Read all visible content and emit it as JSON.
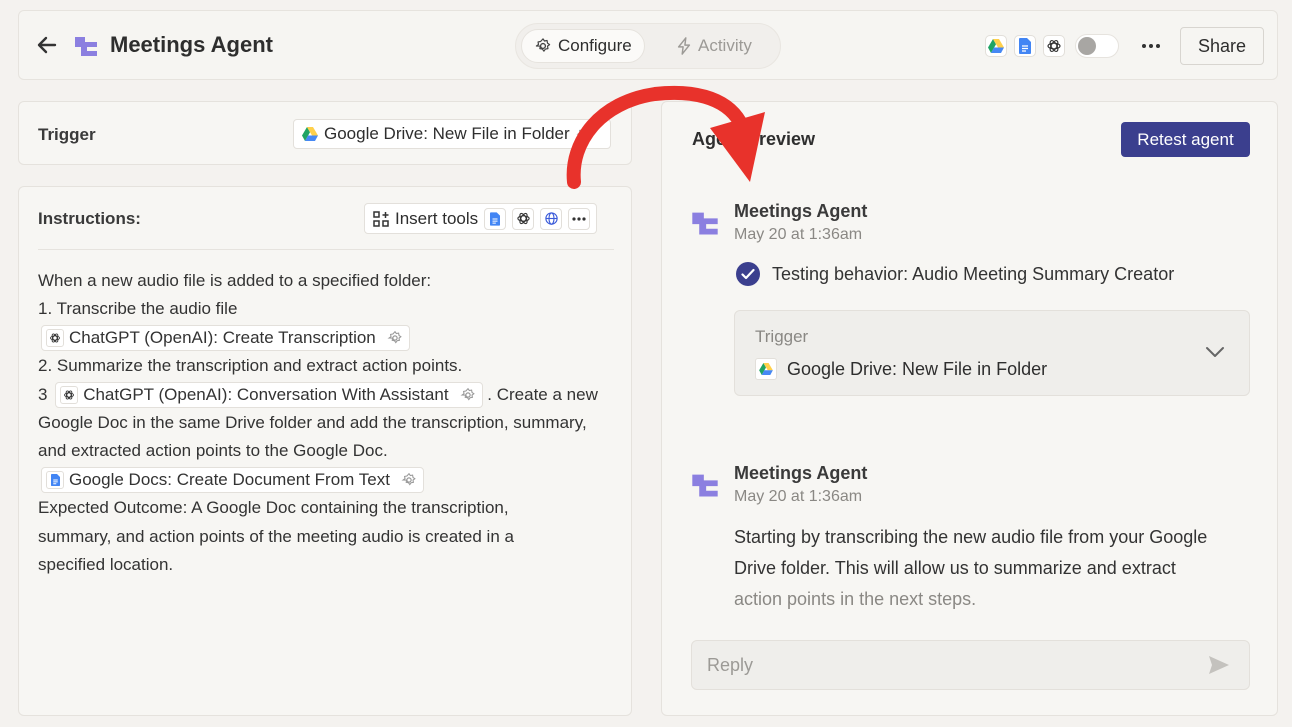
{
  "header": {
    "title": "Meetings Agent",
    "tabs": [
      {
        "label": "Configure",
        "active": true
      },
      {
        "label": "Activity",
        "active": false
      }
    ],
    "share_label": "Share",
    "apps": [
      "google-drive-icon",
      "google-docs-icon",
      "openai-icon"
    ]
  },
  "trigger": {
    "label": "Trigger",
    "value": "Google Drive: New File in Folder"
  },
  "instructions": {
    "label": "Instructions:",
    "insert_tools_label": "Insert tools",
    "lines": {
      "l1": "When a new audio file is added to a specified folder:",
      "l2": "1. Transcribe the audio file",
      "chip1": "ChatGPT (OpenAI): Create Transcription",
      "l3": "2. Summarize the transcription and extract action points.",
      "l4_prefix": "3",
      "chip2": "ChatGPT (OpenAI): Conversation With Assistant",
      "l4_suffix": ". Create a new",
      "l5": "Google Doc in the same Drive folder and add the transcription, summary,",
      "l6": "and extracted action points to the Google Doc.",
      "chip3": "Google Docs: Create Document From Text",
      "l7": "Expected Outcome: A Google Doc containing the transcription,",
      "l8": "summary, and action points of the meeting audio is created in a",
      "l9": "specified location."
    }
  },
  "preview": {
    "title": "Agent preview",
    "retest_label": "Retest agent",
    "messages": [
      {
        "name": "Meetings Agent",
        "time": "May 20 at 1:36am",
        "status": "Testing behavior: Audio Meeting Summary Creator",
        "trigger_label": "Trigger",
        "trigger_value": "Google Drive: New File in Folder"
      },
      {
        "name": "Meetings Agent",
        "time": "May 20 at 1:36am",
        "text_1": "Starting by transcribing the new audio file from your Google",
        "text_2": "Drive folder. This will allow us to summarize and extract",
        "text_3": "action points in the next steps."
      }
    ],
    "reply_placeholder": "Reply"
  },
  "colors": {
    "accent": "#3b3f8e",
    "brand_purple": "#8b7fe0",
    "annotation_red": "#e8322b"
  }
}
